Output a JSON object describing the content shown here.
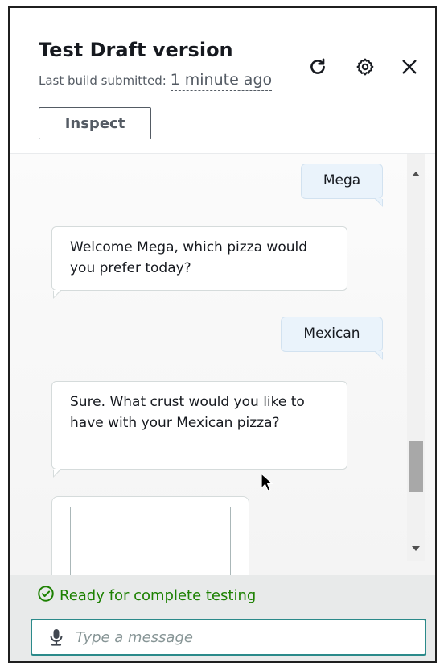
{
  "header": {
    "title": "Test Draft version",
    "build_prefix": "Last build submitted: ",
    "build_time": "1 minute ago",
    "inspect_label": "Inspect",
    "icons": [
      "refresh-icon",
      "settings-icon",
      "close-icon"
    ]
  },
  "chat": {
    "messages": [
      {
        "from": "user",
        "text": "Mega"
      },
      {
        "from": "bot",
        "text": "Welcome Mega, which pizza would you prefer today?"
      },
      {
        "from": "user",
        "text": "Mexican"
      },
      {
        "from": "bot",
        "text": "Sure. What crust would you like to have with your Mexican pizza?"
      }
    ]
  },
  "footer": {
    "status_text": "Ready for complete testing",
    "input_placeholder": "Type a message",
    "input_value": ""
  },
  "colors": {
    "status_green": "#1d8102",
    "input_border": "#2b8a8a",
    "user_bubble": "#eaf3fb",
    "bot_bubble": "#ffffff"
  }
}
